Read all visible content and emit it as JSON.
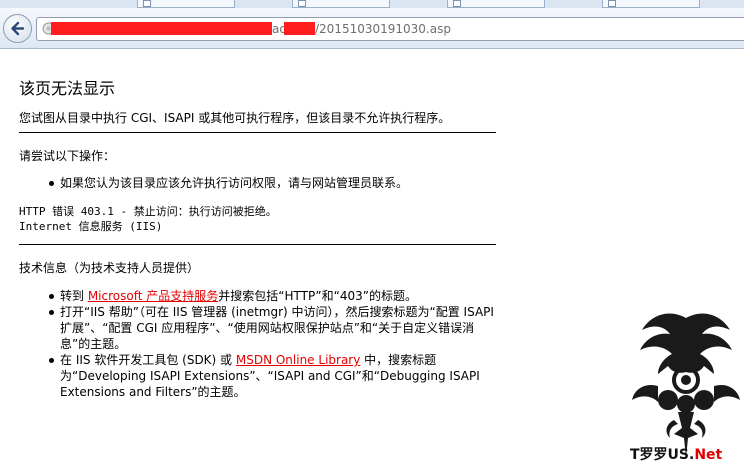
{
  "browser": {
    "url_path": "adv/",
    "url_file": "/20151030191030.asp"
  },
  "page": {
    "title": "该页无法显示",
    "description": "您试图从目录中执行 CGI、ISAPI 或其他可执行程序，但该目录不允许执行程序。",
    "try_heading": "请尝试以下操作：",
    "try_items": [
      "如果您认为该目录应该允许执行访问权限，请与网站管理员联系。"
    ],
    "error_line": "HTTP 错误 403.1 - 禁止访问：执行访问被拒绝。",
    "service_line": "Internet 信息服务 (IIS)",
    "tech_heading": "技术信息（为技术支持人员提供）",
    "tech_items": {
      "item1_prefix": "转到 ",
      "item1_link": "Microsoft 产品支持服务",
      "item1_suffix": "并搜索包括“HTTP”和“403”的标题。",
      "item2": "打开“IIS 帮助”（可在 IIS 管理器 (inetmgr) 中访问），然后搜索标题为“配置 ISAPI 扩展”、“配置 CGI 应用程序”、“使用网站权限保护站点”和“关于自定义错误消息”的主题。",
      "item3_prefix": "在 IIS 软件开发工具包 (SDK) 或 ",
      "item3_link": "MSDN Online Library",
      "item3_suffix": " 中，搜索标题为“Developing ISAPI Extensions”、“ISAPI and CGI”和“Debugging ISAPI Extensions and Filters”的主题。"
    }
  },
  "watermark": {
    "text_main": "T罗罗US.",
    "text_net": "Net"
  },
  "colors": {
    "redaction": "#ff1d1d",
    "link": "#e40000"
  }
}
